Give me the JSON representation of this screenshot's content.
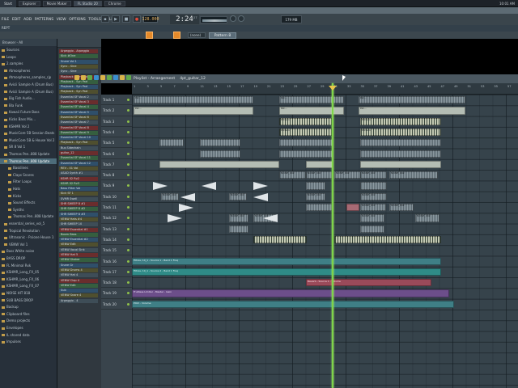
{
  "taskbar": {
    "start_label": "Start",
    "tasks": [
      "Explorer",
      "Movie Maker",
      "FL Studio 20",
      "Chrome"
    ],
    "clock": "10:01 AM"
  },
  "menu": {
    "items": [
      "FILE",
      "EDIT",
      "ADD",
      "PATTERNS",
      "VIEW",
      "OPTIONS",
      "TOOLS",
      "HELP"
    ],
    "hint": "REPT"
  },
  "transport": {
    "tempo": "128.000",
    "time": "2:24",
    "time_sub": ":27",
    "cpu": "179 MB",
    "snap": "(none)",
    "pattern": "Pattern 8"
  },
  "browser": {
    "header": "Browser - All",
    "items": [
      {
        "label": "Sources",
        "selected": false
      },
      {
        "label": "Loops",
        "selected": false
      },
      {
        "label": "2.samples",
        "selected": false
      },
      {
        "label": "Atmospheres",
        "selected": false
      },
      {
        "label": "Atmospheres_samples_rjp",
        "selected": false
      },
      {
        "label": "Avicii Sample A (Drum Bus)",
        "selected": false
      },
      {
        "label": "Avicii Sample A (Drum Bus)",
        "selected": false
      },
      {
        "label": "Big Fish Audio...",
        "selected": false
      },
      {
        "label": "Bla Funk",
        "selected": false
      },
      {
        "label": "Kawaii Future Bass",
        "selected": false
      },
      {
        "label": "Kicks Bass Mix...",
        "selected": false
      },
      {
        "label": "KSHMR Vol 2",
        "selected": false
      },
      {
        "label": "MusicCore 5B Session Beats",
        "selected": false
      },
      {
        "label": "MusicCore 5B & House Vol 2",
        "selected": false
      },
      {
        "label": "SR 8 Vol 1",
        "selected": false
      },
      {
        "label": "Thomas Pen..808 Update",
        "selected": false
      },
      {
        "label": "Thomas Pen..808 Update",
        "selected": true
      },
      {
        "label": "Basslines",
        "selected": false
      },
      {
        "label": "Claps Snares",
        "selected": false
      },
      {
        "label": "Filter Loops",
        "selected": false
      },
      {
        "label": "Hats",
        "selected": false
      },
      {
        "label": "Kicks",
        "selected": false
      },
      {
        "label": "Sound Effects",
        "selected": false
      },
      {
        "label": "Synths",
        "selected": false
      },
      {
        "label": "Thomas Pen..808 Update",
        "selected": false
      },
      {
        "label": "essential_series_vol_5",
        "selected": false
      },
      {
        "label": "Tropical Revolution",
        "selected": false
      },
      {
        "label": "Ultrasonic - P.sione House 1",
        "selected": false
      },
      {
        "label": "VENW Vol 1",
        "selected": false
      },
      {
        "label": "Bass White noise",
        "selected": false
      },
      {
        "label": "BASS DROP",
        "selected": false
      },
      {
        "label": "FL Minimal Rxk",
        "selected": false
      },
      {
        "label": "KSHMR_Long_FX_05",
        "selected": false
      },
      {
        "label": "KSHMR_Long_FX_06",
        "selected": false
      },
      {
        "label": "KSHMR_Long_FX_07",
        "selected": false
      },
      {
        "label": "NOISE HIT 818",
        "selected": false
      },
      {
        "label": "SUB BASS DROP",
        "selected": false
      },
      {
        "label": "Backup",
        "selected": false
      },
      {
        "label": "Clipboard files",
        "selected": false
      },
      {
        "label": "Demo projects",
        "selected": false
      },
      {
        "label": "Envelopes",
        "selected": false
      },
      {
        "label": "IL shared data",
        "selected": false
      },
      {
        "label": "Impulses",
        "selected": false
      }
    ]
  },
  "track_panel": {
    "rows": [
      "Arpeggio - Arpeggio",
      "Kick #One",
      "Snare Vol 1",
      "Sync - Sine",
      "Sync - Sine",
      "Playback - Syn Pad",
      "Playback - Syn Pad",
      "Playback - Syn Pad",
      "Playback - Syn Pad",
      "Essential SF Vocal 2",
      "Essential SF Vocal 3",
      "Essential SF Vocal 4",
      "Essential SF Vocal 5",
      "Essential SF Vocal 6",
      "Essential SF Vocal 7",
      "Essential SF Vocal 8",
      "Essential SF Vocal 9",
      "Essential SF Vocal 10",
      "Playback - Syn Pad",
      "Bus Sidechain",
      "guitar_12",
      "Essential SF Vocal 11",
      "Essential SF Vocal 12",
      "REV - 01 Vol",
      "ASAD Synth #1",
      "KSHR 02 Rv2",
      "KSHR 02 Rv3",
      "Bass Filter Vol",
      "Kick SF 1",
      "SVMR Swell",
      "SHR SWEEP 8 #1",
      "SHR SWEEP 8 #2",
      "SHR SWEEP 8 #3",
      "VENW Hats #4",
      "SHR SWEEP 10",
      "VENW Essential #1",
      "Boom Bass",
      "VENW Essential #2",
      "VENW Edit",
      "VENW Vocal Sink",
      "VENW Hat 5",
      "VENW Shaker",
      "Snare Gr",
      "VENW Drums 4",
      "VENW Hat 4",
      "VENW Clap 4",
      "VENW Edit",
      "Sub",
      "VENW Snare 4",
      "Arpeggio - 4"
    ]
  },
  "playlist": {
    "title": "Playlist - Arrangement",
    "pattern_name": "4pt_guitar_12",
    "ruler": [
      "1",
      "3",
      "5",
      "7",
      "9",
      "11",
      "13",
      "15",
      "17",
      "19",
      "21",
      "23",
      "25",
      "27",
      "29",
      "31",
      "33",
      "35",
      "37",
      "39",
      "41",
      "43",
      "45",
      "47",
      "49",
      "51",
      "53",
      "55",
      "57",
      "59"
    ],
    "tracks": [
      "Track 1",
      "Track 2",
      "Track 3",
      "Track 4",
      "Track 5",
      "Track 6",
      "Track 7",
      "Track 8",
      "Track 9",
      "Track 10",
      "Track 11",
      "Track 12",
      "Track 13",
      "Track 14",
      "Track 15",
      "Track 16",
      "Track 17",
      "Track 18",
      "Track 19",
      "Track 20"
    ],
    "automation": {
      "a": "Filtres, 10_1 - Source 1 - Band 1 Freq",
      "b": "Filtres, 10_1 - Source 2 - Band 1 Freq",
      "c": "Reverb - Source 1 - Volume",
      "d": "Fruitless Limiter - Master - Gain",
      "e": "Pitch - Volume"
    },
    "clip_labels": {
      "p1": "Pat...",
      "p2": "Pat...",
      "v": "NOISE_002",
      "n": "Pattern"
    }
  }
}
